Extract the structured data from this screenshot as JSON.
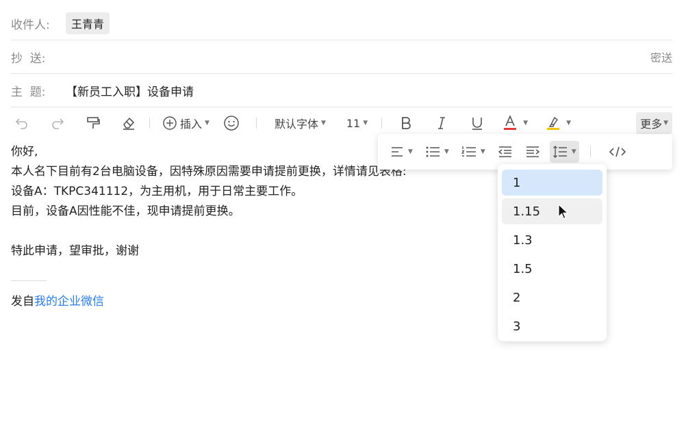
{
  "header": {
    "to_label": "收件人:",
    "recipient": "王青青",
    "cc_label": "抄  送:",
    "bcc_label": "密送",
    "subject_label": "主  题:",
    "subject": "【新员工入职】设备申请"
  },
  "toolbar": {
    "insert_label": "插入",
    "font_label": "默认字体",
    "size_label": "11",
    "more_label": "更多",
    "accent_color": "#e23b3b",
    "highlight_color": "#f2c200"
  },
  "body": {
    "lines": [
      "你好,",
      "本人名下目前有2台电脑设备，因特殊原因需要申请提前更换，详情请见表格:",
      "设备A：TKPC341112，为主用机，用于日常主要工作。",
      "目前，设备A因性能不佳，现申请提前更换。",
      "特此申请，望审批，谢谢"
    ],
    "signature_prefix": "发自",
    "signature_link": "我的企业微信"
  },
  "line_spacing": {
    "options": [
      "1",
      "1.15",
      "1.3",
      "1.5",
      "2",
      "3"
    ],
    "selected": "1",
    "hovered": "1.15",
    "selected_color": "#d6e6fb"
  }
}
